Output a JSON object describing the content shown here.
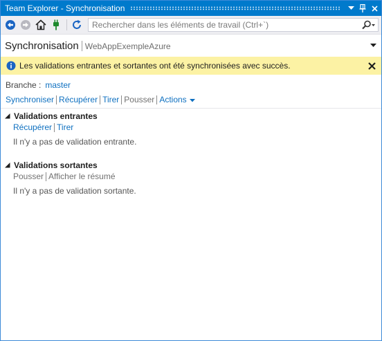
{
  "window": {
    "title": "Team Explorer - Synchronisation"
  },
  "toolbar": {
    "search_placeholder": "Rechercher dans les éléments de travail (Ctrl+`)",
    "icons": [
      "back-icon",
      "forward-icon",
      "home-icon",
      "connect-icon",
      "refresh-icon",
      "search-icon"
    ]
  },
  "header": {
    "title": "Synchronisation",
    "subtitle": "WebAppExempleAzure"
  },
  "info": {
    "message": "Les validations entrantes et sortantes ont été synchronisées avec succès."
  },
  "branch": {
    "label": "Branche :",
    "name": "master"
  },
  "actions": {
    "sync": "Synchroniser",
    "fetch": "Récupérer",
    "pull": "Tirer",
    "push": "Pousser",
    "more": "Actions"
  },
  "incoming": {
    "title": "Validations entrantes",
    "fetch": "Récupérer",
    "pull": "Tirer",
    "empty": "Il n'y a pas de validation entrante."
  },
  "outgoing": {
    "title": "Validations sortantes",
    "push": "Pousser",
    "summary": "Afficher le résumé",
    "empty": "Il n'y a pas de validation sortante."
  },
  "colors": {
    "accent": "#007acc",
    "link": "#0e70c0",
    "info_bg": "#fcf2a4",
    "toolbar_bg": "#eeeef2"
  }
}
